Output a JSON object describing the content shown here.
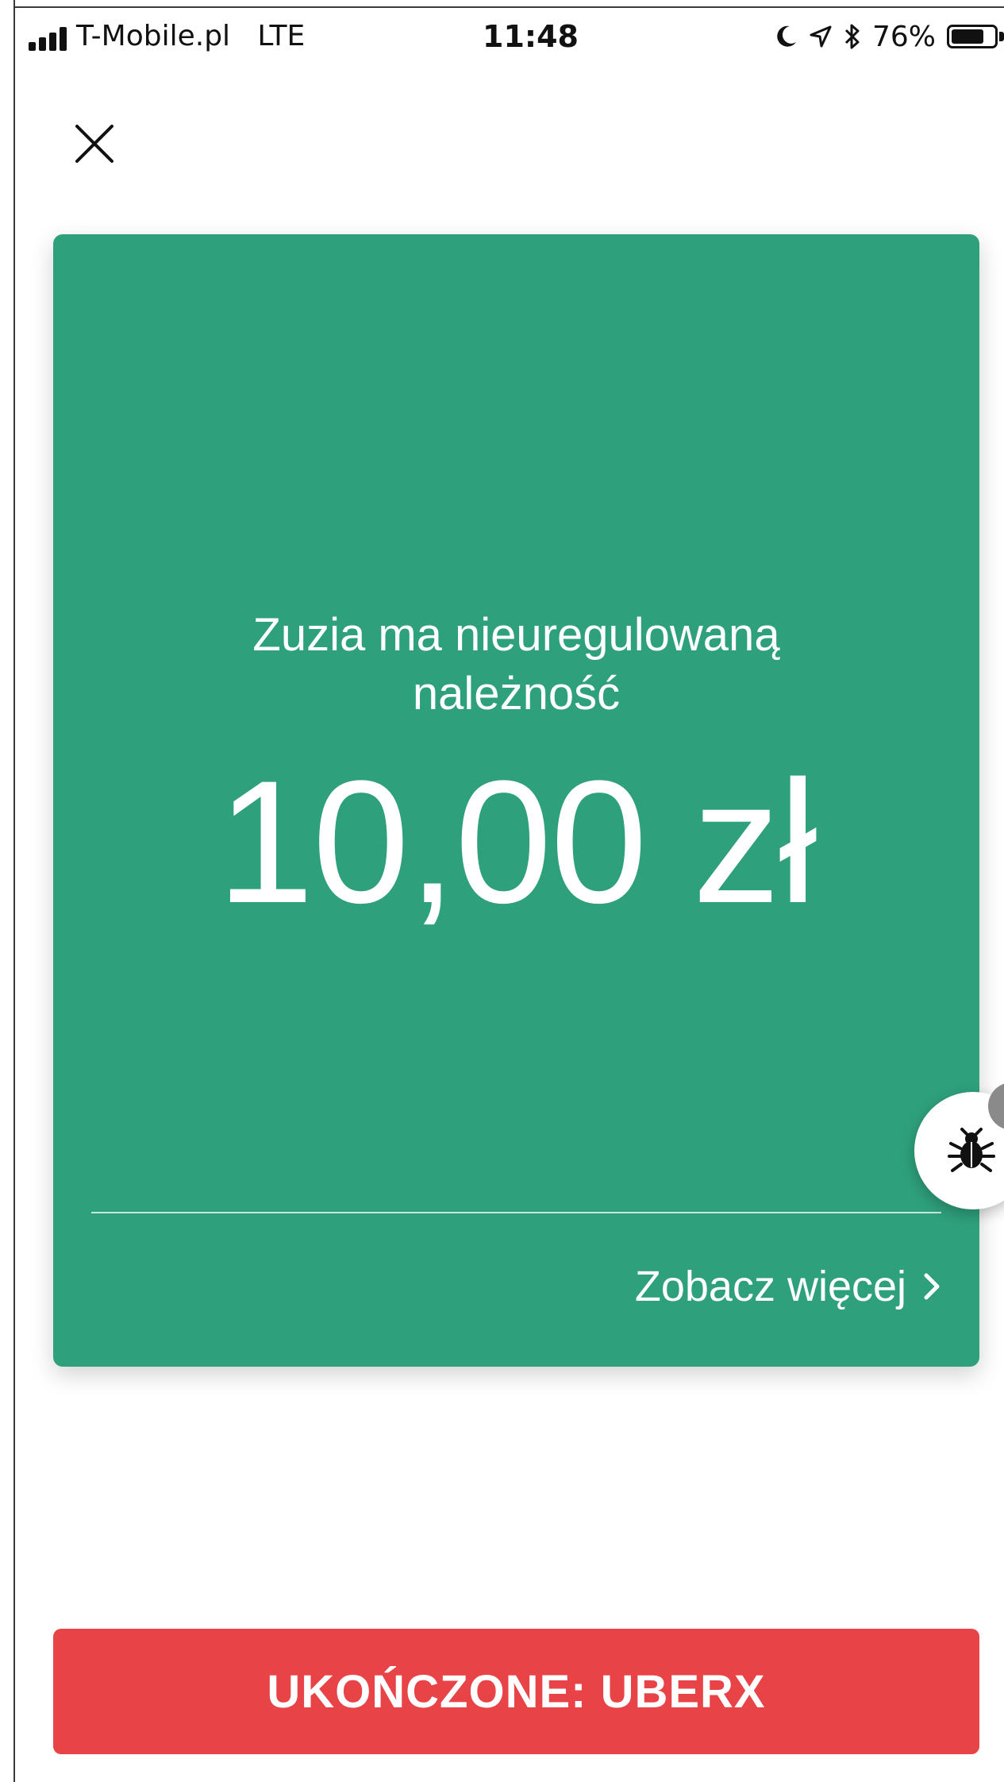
{
  "status_bar": {
    "carrier": "T-Mobile.pl",
    "network": "LTE",
    "time": "11:48",
    "battery_percent": "76%",
    "battery_level": 0.76,
    "icons": [
      "signal-icon",
      "moon-icon",
      "location-arrow-icon",
      "bluetooth-icon",
      "battery-icon"
    ]
  },
  "header": {
    "close_icon": "close-icon"
  },
  "card": {
    "message": "Zuzia ma nieuregulowaną należność",
    "amount": "10,00 zł",
    "see_more_label": "Zobacz więcej",
    "see_more_icon": "chevron-right-icon",
    "background_color": "#2fa07c"
  },
  "debug_button": {
    "icon": "bug-icon"
  },
  "footer": {
    "button_label": "UKOŃCZONE: UBERX",
    "button_color": "#e84347"
  }
}
